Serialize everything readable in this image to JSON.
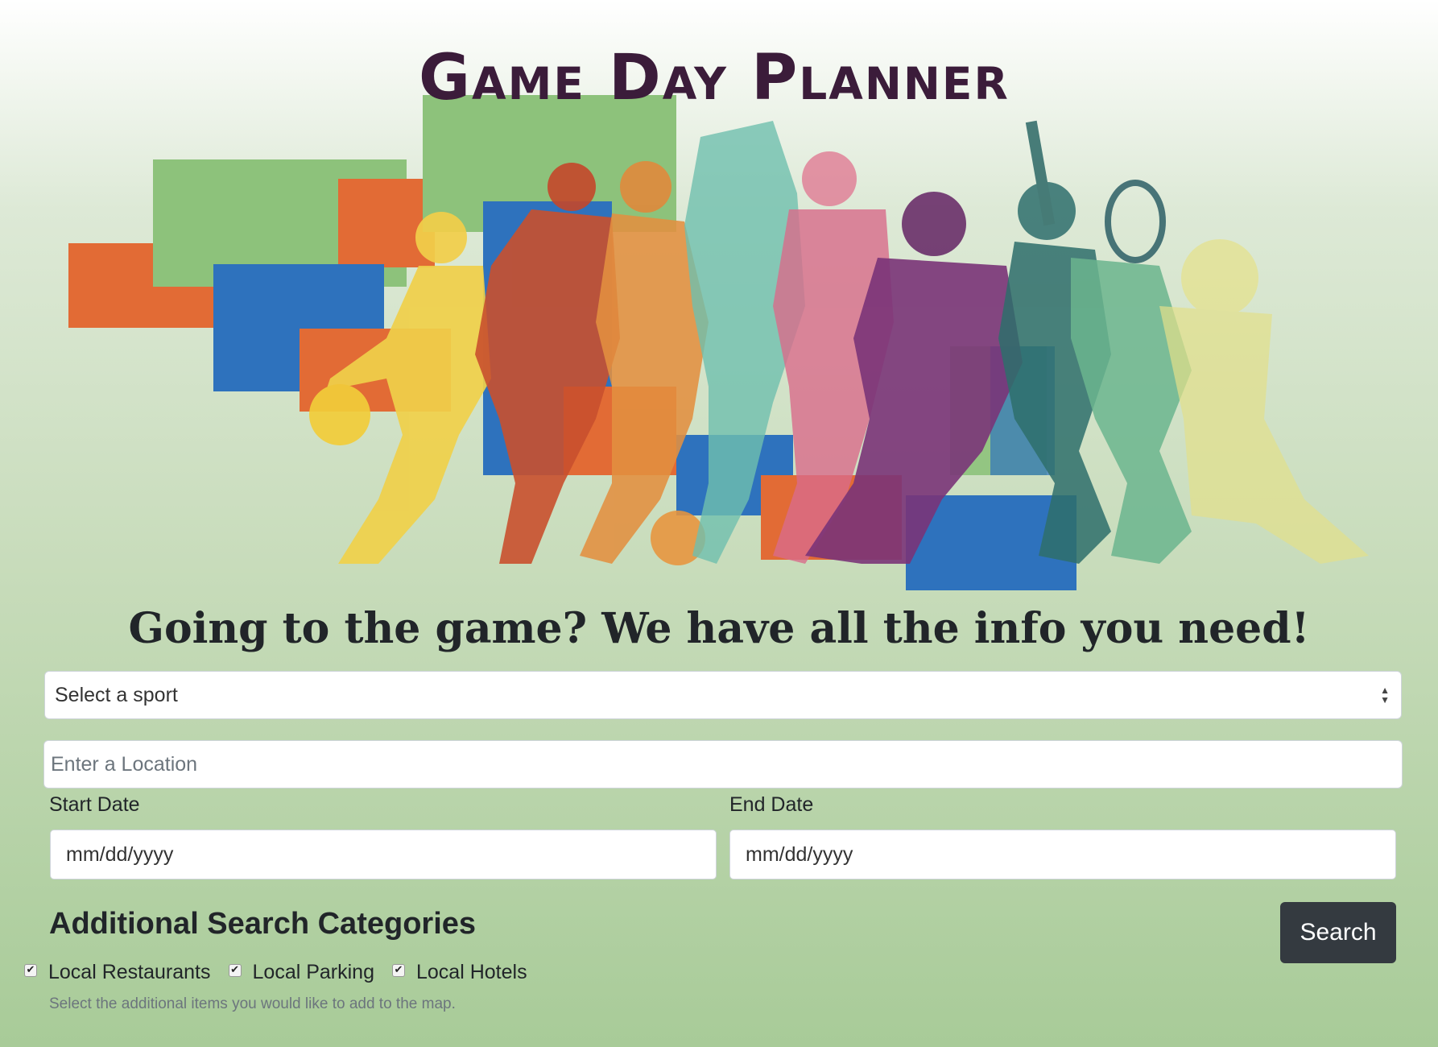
{
  "header": {
    "title": "Game Day Planner"
  },
  "hero": {
    "tagline": "Going to the game? We have all the info you need!"
  },
  "form": {
    "sport_select": {
      "selected": "Select a sport"
    },
    "location": {
      "placeholder": "Enter a Location"
    },
    "start_date": {
      "label": "Start Date",
      "value": "mm/dd/yyyy"
    },
    "end_date": {
      "label": "End Date",
      "value": "mm/dd/yyyy"
    },
    "categories": {
      "heading": "Additional Search Categories",
      "items": [
        {
          "label": "Local Restaurants",
          "checked": true
        },
        {
          "label": "Local Parking",
          "checked": true
        },
        {
          "label": "Local Hotels",
          "checked": true
        }
      ],
      "help_text": "Select the additional items you would like to add to the map."
    },
    "search_button": "Search"
  },
  "colors": {
    "title": "#3b1c3a",
    "button_bg": "#343a40",
    "hero_green": "#8dc27b",
    "hero_orange": "#e26b35",
    "hero_blue": "#2e72bd"
  }
}
